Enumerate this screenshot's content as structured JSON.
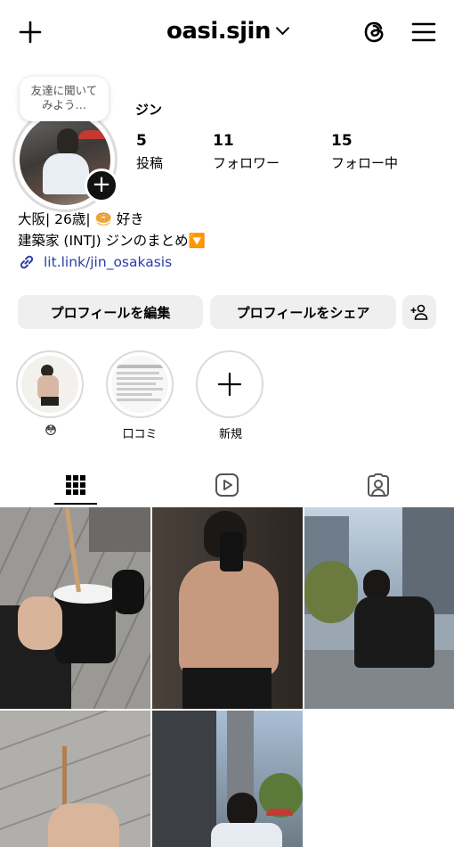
{
  "header": {
    "username": "oasi.sjin",
    "icons": [
      "plus-icon",
      "chevron-down-icon",
      "threads-icon",
      "menu-icon"
    ]
  },
  "profile": {
    "note_bubble": "友達に聞いて\nみよう…",
    "display_name": "ジン",
    "stats": [
      {
        "value": "5",
        "label": "投稿"
      },
      {
        "value": "11",
        "label": "フォロワー"
      },
      {
        "value": "15",
        "label": "フォロー中"
      }
    ],
    "bio_line1": "大阪| 26歳| 🥯 好き",
    "bio_line2": "建築家 (INTJ)   ジンのまとめ🔽",
    "link": "lit.link/jin_osakasis"
  },
  "buttons": {
    "edit_profile": "プロフィールを編集",
    "share_profile": "プロフィールをシェア"
  },
  "highlights": [
    {
      "label": "😳"
    },
    {
      "label": "口コミ"
    },
    {
      "label": "新規"
    }
  ],
  "tabs": [
    "grid-icon",
    "reels-icon",
    "tagged-icon"
  ],
  "colors": {
    "link": "#2b3ea8",
    "button_bg": "#efefef",
    "ring": "#dbdbdb"
  }
}
